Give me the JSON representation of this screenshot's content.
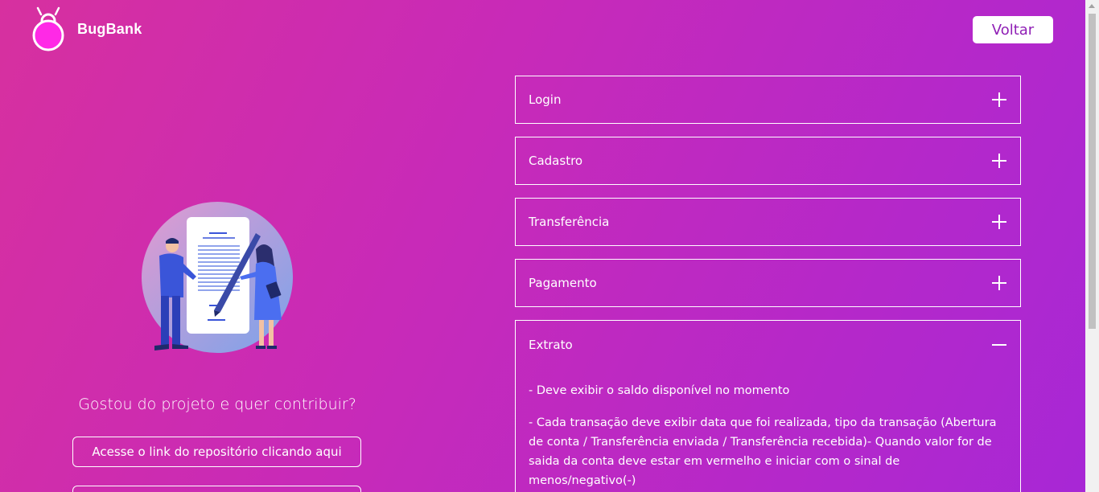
{
  "header": {
    "brand": "BugBank",
    "back_label": "Voltar"
  },
  "contrib": {
    "title": "Gostou do projeto e quer contribuir?",
    "repo_link_label": "Acesse o link do repositório clicando aqui"
  },
  "accordion": {
    "items": [
      {
        "label": "Login",
        "icon": "plus-icon"
      },
      {
        "label": "Cadastro",
        "icon": "plus-icon"
      },
      {
        "label": "Transferência",
        "icon": "plus-icon"
      },
      {
        "label": "Pagamento",
        "icon": "plus-icon"
      }
    ],
    "open": {
      "label": "Extrato",
      "icon": "minus-icon",
      "body": [
        "- Deve exibir o saldo disponível no momento",
        "- Cada transação deve exibir data que foi realizada, tipo da transação (Abertura de conta / Transferência enviada / Transferência recebida)- Quando valor for de saida da conta deve estar em vermelho e iniciar com o sinal de menos/negativo(-)"
      ]
    }
  },
  "colors": {
    "gradient_start": "#d7309f",
    "gradient_end": "#a727d6",
    "accent": "#8f1fb5"
  }
}
